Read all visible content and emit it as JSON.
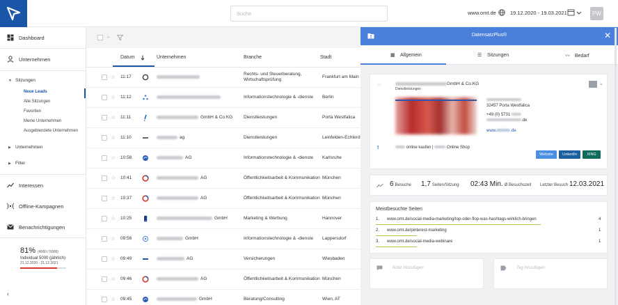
{
  "topbar": {
    "search_placeholder": "Suche",
    "domain": "www.omt.de",
    "date_range": "19.12.2020 - 19.03.2021",
    "user_initials": "PW"
  },
  "sidebar": {
    "dashboard": "Dashboard",
    "companies": "Unternehmen",
    "sessions_group": "Sitzungen",
    "session_items": [
      "Neue Leads",
      "Alle Sitzungen",
      "Favoriten",
      "Meine Unternehmen",
      "Ausgeblendete Unternehmen"
    ],
    "companies_group": "Unternehmen",
    "filter_group": "Filter",
    "interests": "Interessen",
    "offline": "Offline-Kampagnen",
    "notifications": "Benachrichtigungen",
    "quota_pct": "81%",
    "quota_count": "(4060 / 5000)",
    "quota_plan": "Individual 5000 (jährlich)",
    "quota_range": "21.12.2020 - 21.12.2021",
    "quota_fraction": 0.81
  },
  "table": {
    "headers": {
      "date": "Datum",
      "company": "Unternehmen",
      "industry": "Branche",
      "city": "Stadt"
    },
    "rows": [
      {
        "time": "11:17",
        "suffix": "",
        "industry": "Rechts- und Steuerberatung, Wirtschaftsprüfung",
        "city": "Frankfurt am Main",
        "icon": "circle",
        "color": "#333"
      },
      {
        "time": "11:12",
        "suffix": "",
        "industry": "Informationstechnologie & -dienste",
        "city": "Berlin",
        "icon": "tri",
        "color": "#4a7fdc"
      },
      {
        "time": "11:11",
        "suffix": "GmbH & Co.KG",
        "industry": "Dienstleistungen",
        "city": "Porta Westfalica",
        "icon": "excl",
        "color": "#1a56a8"
      },
      {
        "time": "11:10",
        "suffix": "ag",
        "industry": "Dienstleistungen",
        "city": "Leinfelden-Echterdingen",
        "icon": "dash",
        "color": "#666"
      },
      {
        "time": "10:58",
        "suffix": "AG",
        "industry": "Informationstechnologie & -dienste",
        "city": "Karlsruhe",
        "icon": "disc",
        "color": "#2a5db8"
      },
      {
        "time": "10:41",
        "suffix": "AG",
        "industry": "Öffentlichkeitsarbeit & Kommunikation",
        "city": "München",
        "icon": "ring",
        "color": "#d9362b"
      },
      {
        "time": "10:37",
        "suffix": "AG",
        "industry": "Öffentlichkeitsarbeit & Kommunikation",
        "city": "München",
        "icon": "ring",
        "color": "#d9362b"
      },
      {
        "time": "10:25",
        "suffix": "GmbH",
        "industry": "Marketing & Werbung",
        "city": "Hannover",
        "icon": "phone",
        "color": "#1a3c8a"
      },
      {
        "time": "09:56",
        "suffix": "GmbH",
        "industry": "Informationstechnologie & -dienste",
        "city": "Lappersdorf",
        "icon": "o",
        "color": "#4a7fdc"
      },
      {
        "time": "09:49",
        "suffix": "AG",
        "industry": "Versicherungen",
        "city": "Wiesbaden",
        "icon": "dash",
        "color": "#1a56a8"
      },
      {
        "time": "09:46",
        "suffix": "AG",
        "industry": "Öffentlichkeitsarbeit & Kommunikation",
        "city": "München",
        "icon": "ring",
        "color": "#d9362b"
      },
      {
        "time": "09:45",
        "suffix": "GmbH",
        "industry": "Beratung/Consulting",
        "city": "Wien, AT",
        "icon": "disc",
        "color": "#2a5db8"
      }
    ]
  },
  "panel": {
    "title": "DatensatzPlus®",
    "tabs": [
      "Allgemein",
      "Sitzungen",
      "Bedarf"
    ],
    "company_suffix": "GmbH & Co.KG",
    "company_category": "Dienstleistungen",
    "city": "32457 Porta Westfalica",
    "phone": "+49 (0) 5731",
    "email_domain": ".de",
    "website_suffix": ".de",
    "online_text": "online kaufen |",
    "online_shop": "Online Shop",
    "buttons": {
      "website": "Website",
      "linkedin": "LinkedIn",
      "xing": "XING"
    },
    "stats": {
      "visits_value": "6",
      "visits_label": "Besuche",
      "pages_value": "1,7",
      "pages_label": "Seiten/Sitzung",
      "time_value": "02:43 Min.",
      "time_label": "Ø Besuchszeit",
      "last_label": "Letzter Besuch",
      "last_value": "12.03.2021"
    },
    "most_visited_title": "Meistbesuchte Seiten",
    "pages": [
      {
        "n": "1.",
        "url": "www.omt.de/social-media-marketing/top-oder-flop-was-hashtags-wirklich-bringen",
        "count": "4",
        "fraction": 1.0
      },
      {
        "n": "2.",
        "url": "www.omt.de/pinterest-marketing",
        "count": "1",
        "fraction": 0.25
      },
      {
        "n": "3.",
        "url": "www.omt.de/social-media-webinare",
        "count": "1",
        "fraction": 0.25
      }
    ],
    "note_placeholder": "Notiz hinzufügen",
    "tag_placeholder": "Tag hinzufügen"
  },
  "colors": {
    "brand": "#1a56a8",
    "panel_header": "#4a7fdc",
    "linkedin": "#1a5f9e",
    "xing": "#0f6b5c",
    "website": "#4a8fe0"
  }
}
